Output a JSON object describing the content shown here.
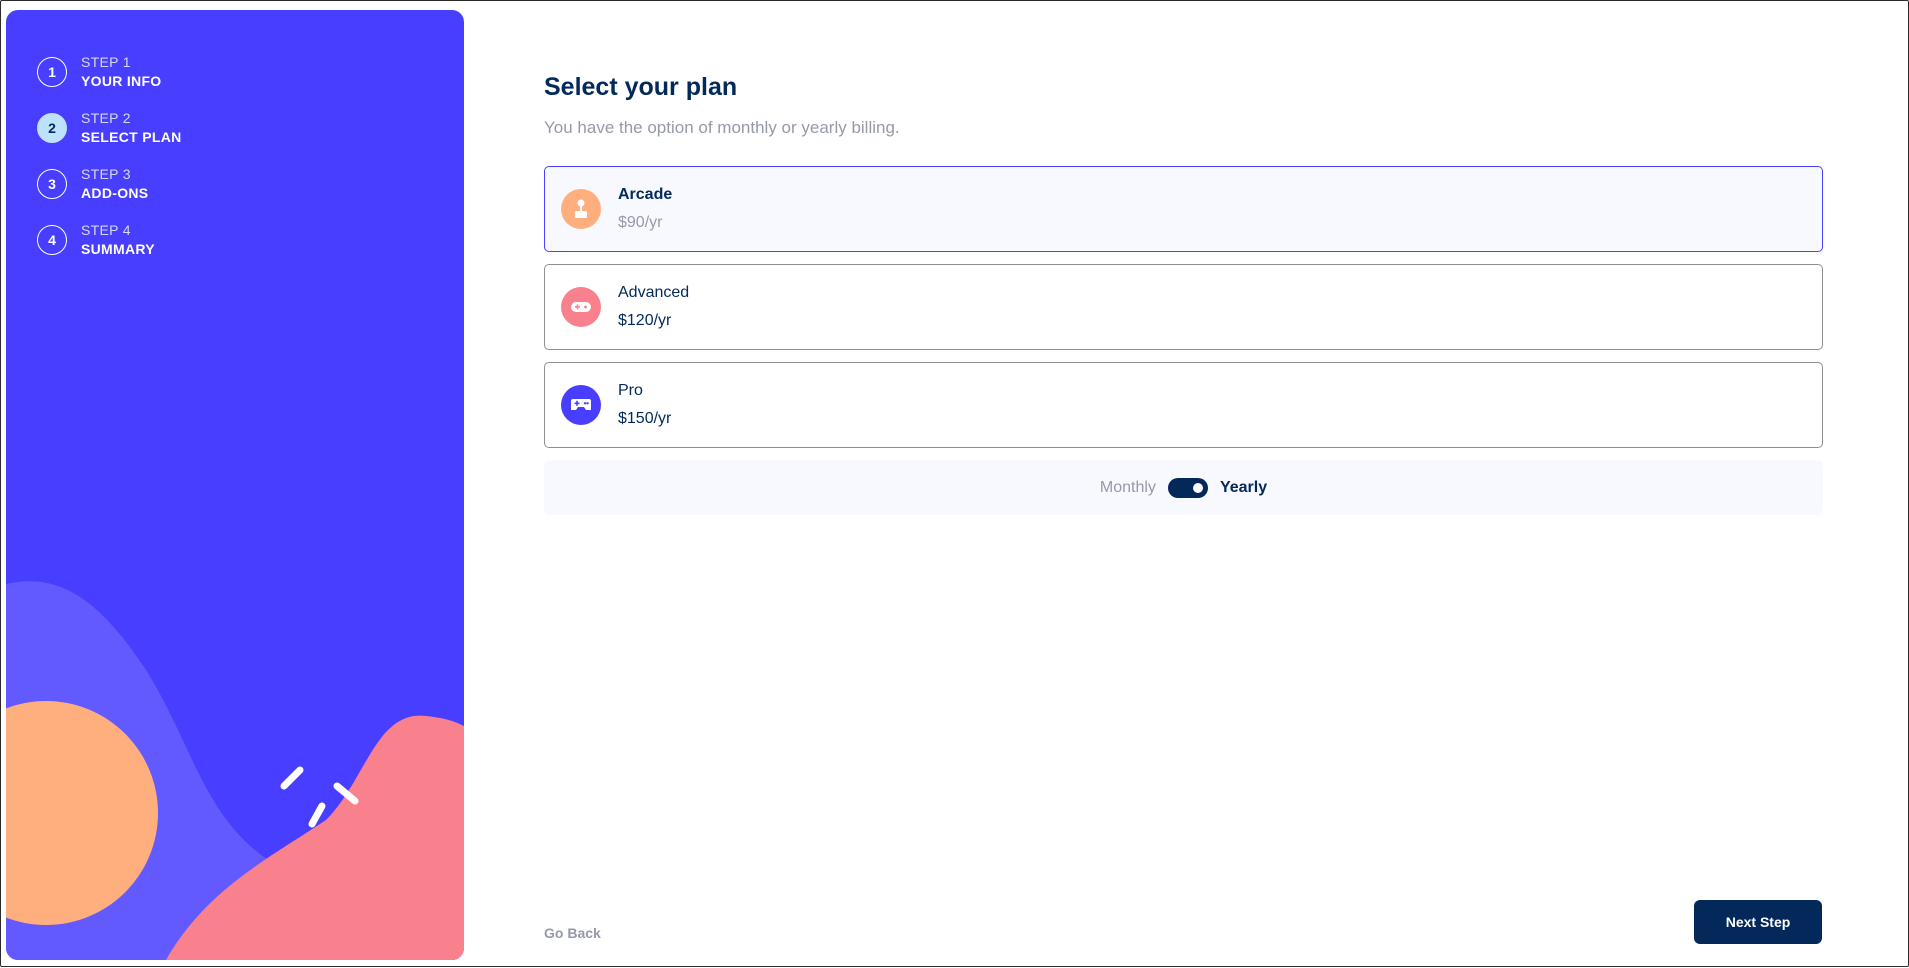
{
  "sidebar": {
    "steps": [
      {
        "number": "1",
        "label": "STEP 1",
        "title": "YOUR INFO",
        "active": false
      },
      {
        "number": "2",
        "label": "STEP 2",
        "title": "SELECT PLAN",
        "active": true
      },
      {
        "number": "3",
        "label": "STEP 3",
        "title": "ADD-ONS",
        "active": false
      },
      {
        "number": "4",
        "label": "STEP 4",
        "title": "SUMMARY",
        "active": false
      }
    ]
  },
  "main": {
    "title": "Select your plan",
    "subtitle": "You have the option of monthly or yearly billing.",
    "plans": [
      {
        "name": "Arcade",
        "price": "$90/yr",
        "icon": "arcade-joystick-icon",
        "icon_color": "#ffaf7e",
        "selected": true
      },
      {
        "name": "Advanced",
        "price": "$120/yr",
        "icon": "gamepad-icon",
        "icon_color": "#f9818e",
        "selected": false
      },
      {
        "name": "Pro",
        "price": "$150/yr",
        "icon": "controller-icon",
        "icon_color": "#483eff",
        "selected": false
      }
    ],
    "billing": {
      "monthly_label": "Monthly",
      "yearly_label": "Yearly",
      "yearly_selected": true
    },
    "go_back_label": "Go Back",
    "next_label": "Next Step"
  },
  "colors": {
    "sidebar_bg": "#483eff",
    "primary_dark": "#022959",
    "muted_text": "#9699aa",
    "active_step_bg": "#bee2fd"
  }
}
